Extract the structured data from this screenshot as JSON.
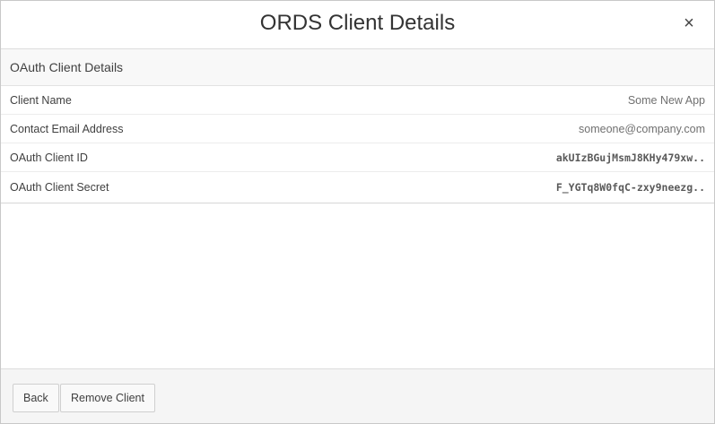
{
  "dialog": {
    "title": "ORDS Client Details",
    "close_glyph": "×"
  },
  "region": {
    "header": "OAuth Client Details",
    "rows": [
      {
        "label": "Client Name",
        "value": "Some New App"
      },
      {
        "label": "Contact Email Address",
        "value": "someone@company.com"
      },
      {
        "label": "OAuth Client ID",
        "value": "akUIzBGujMsmJ8KHy479xw.."
      },
      {
        "label": "OAuth Client Secret",
        "value": "F_YGTq8W0fqC-zxy9neezg.."
      }
    ]
  },
  "footer": {
    "back_label": "Back",
    "remove_label": "Remove Client"
  }
}
